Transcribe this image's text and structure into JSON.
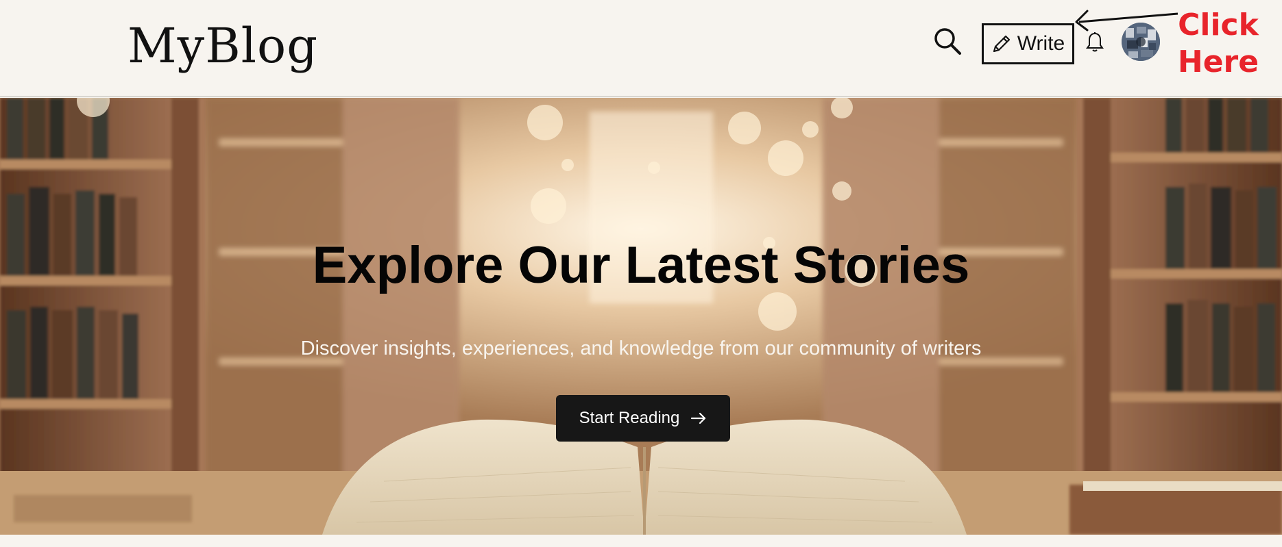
{
  "header": {
    "logo_text": "MyBlog",
    "write_label": "Write",
    "icons": {
      "search": "search-icon",
      "write": "pencil-icon",
      "notifications": "bell-icon",
      "avatar": "user-avatar"
    }
  },
  "annotation": {
    "text": "Click\nHere",
    "color": "#e8242b"
  },
  "hero": {
    "title": "Explore Our Latest Stories",
    "subtitle": "Discover insights, experiences, and knowledge from our community of writers",
    "cta_label": "Start Reading",
    "cta_icon": "arrow-right-icon"
  },
  "colors": {
    "page_bg": "#f7f4ef",
    "cta_bg": "#171717",
    "title": "#050505",
    "subtitle": "#f8f4ee"
  }
}
